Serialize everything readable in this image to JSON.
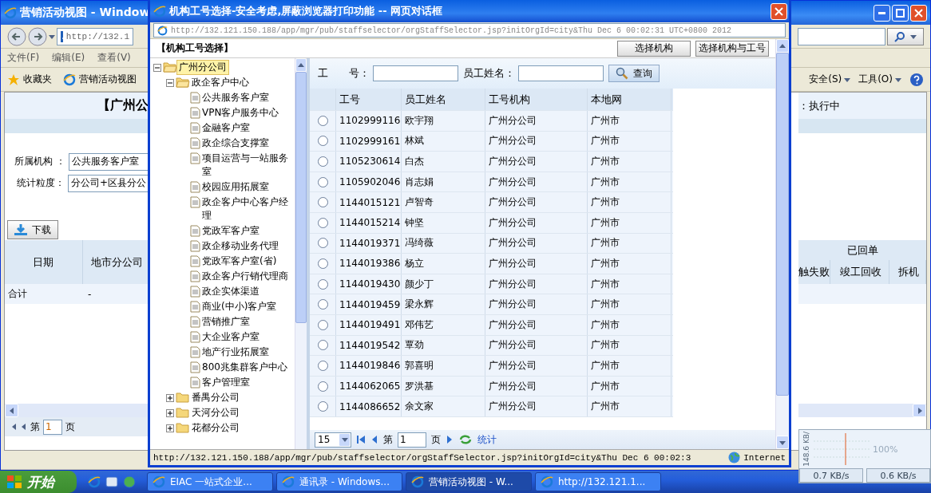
{
  "browser": {
    "title": "营销活动视图 - Window",
    "address": "http://132.1",
    "menu": [
      "文件(F)",
      "编辑(E)",
      "查看(V)"
    ],
    "favorites": "收藏夹",
    "tab": "营销活动视图",
    "right_menu": [
      "安全(S)",
      "工具(O)"
    ],
    "page": {
      "heading": "【广州公",
      "status": "：执行中",
      "fields": [
        {
          "label": "所属机构 ：",
          "value": "公共服务客户室"
        },
        {
          "label": "统计粒度：",
          "value": "分公司+区县分公"
        }
      ],
      "download": "下载",
      "table_left": {
        "columns": [
          "日期",
          "地市分公司"
        ],
        "row": [
          "合计",
          "-"
        ]
      },
      "table_right": {
        "group": "已回单",
        "columns": [
          "触失败",
          "竣工回收",
          "拆机"
        ]
      },
      "pager": {
        "prefix": "第",
        "page": "1",
        "suffix": "页"
      }
    }
  },
  "dialog": {
    "title": "机构工号选择-安全考虑,屏蔽浏览器打印功能 -- 网页对话框",
    "address": "http://132.121.150.188/app/mgr/pub/staffselector/orgStaffSelector.jsp?initOrgId=city&Thu Dec 6 00:02:31 UTC+0800 2012",
    "header": "【机构工号选择】",
    "buttons": [
      "选择机构",
      "选择机构与工号"
    ],
    "tree": [
      {
        "label": "广州分公司",
        "selected": true,
        "expanded": true,
        "children": [
          {
            "label": "政企客户中心",
            "selected": false,
            "expanded": true,
            "children": [
              {
                "label": "公共服务客户室",
                "selected": false
              },
              {
                "label": "VPN客户服务中心",
                "selected": false
              },
              {
                "label": "金融客户室",
                "selected": false
              },
              {
                "label": "政企综合支撑室",
                "selected": false
              },
              {
                "label": "项目运营与一站服务室",
                "selected": false
              },
              {
                "label": "校园应用拓展室",
                "selected": false
              },
              {
                "label": "政企客户中心客户经理",
                "selected": false
              },
              {
                "label": "党政军客户室",
                "selected": false
              },
              {
                "label": "政企移动业务代理",
                "selected": false
              },
              {
                "label": "党政军客户室(省)",
                "selected": false
              },
              {
                "label": "政企客户行销代理商",
                "selected": false
              },
              {
                "label": "政企实体渠道",
                "selected": false
              },
              {
                "label": "商业(中小)客户室",
                "selected": false
              },
              {
                "label": "营销推广室",
                "selected": false
              },
              {
                "label": "大企业客户室",
                "selected": false
              },
              {
                "label": "地产行业拓展室",
                "selected": false
              },
              {
                "label": "800兆集群客户中心",
                "selected": false
              },
              {
                "label": "客户管理室",
                "selected": false
              }
            ]
          },
          {
            "label": "番禺分公司",
            "selected": false,
            "expanded": false
          },
          {
            "label": "天河分公司",
            "selected": false,
            "expanded": false
          },
          {
            "label": "花都分公司",
            "selected": false,
            "expanded": false
          }
        ]
      }
    ],
    "search": {
      "fields": [
        {
          "label": "工　　号："
        },
        {
          "label": "员工姓名："
        }
      ],
      "button": "查询"
    },
    "table": {
      "columns": [
        "工号",
        "员工姓名",
        "工号机构",
        "本地网"
      ],
      "rows": [
        {
          "selected": false,
          "cells": [
            "1102999116",
            "欧宇翔",
            "广州分公司",
            "广州市"
          ]
        },
        {
          "selected": false,
          "cells": [
            "1102999161",
            "林斌",
            "广州分公司",
            "广州市"
          ]
        },
        {
          "selected": false,
          "cells": [
            "1105230614",
            "白杰",
            "广州分公司",
            "广州市"
          ]
        },
        {
          "selected": false,
          "cells": [
            "1105902046",
            "肖志娟",
            "广州分公司",
            "广州市"
          ]
        },
        {
          "selected": false,
          "cells": [
            "1144015121",
            "卢智奇",
            "广州分公司",
            "广州市"
          ]
        },
        {
          "selected": false,
          "cells": [
            "1144015214",
            "钟坚",
            "广州分公司",
            "广州市"
          ]
        },
        {
          "selected": false,
          "cells": [
            "1144019371",
            "冯绮薇",
            "广州分公司",
            "广州市"
          ]
        },
        {
          "selected": false,
          "cells": [
            "1144019386",
            "杨立",
            "广州分公司",
            "广州市"
          ]
        },
        {
          "selected": false,
          "cells": [
            "1144019430",
            "颜少丁",
            "广州分公司",
            "广州市"
          ]
        },
        {
          "selected": false,
          "cells": [
            "1144019459",
            "梁永辉",
            "广州分公司",
            "广州市"
          ]
        },
        {
          "selected": false,
          "cells": [
            "1144019491",
            "邓伟艺",
            "广州分公司",
            "广州市"
          ]
        },
        {
          "selected": false,
          "cells": [
            "1144019542",
            "覃劲",
            "广州分公司",
            "广州市"
          ]
        },
        {
          "selected": false,
          "cells": [
            "1144019846",
            "郭喜明",
            "广州分公司",
            "广州市"
          ]
        },
        {
          "selected": false,
          "cells": [
            "1144062065",
            "罗洪基",
            "广州分公司",
            "广州市"
          ]
        },
        {
          "selected": false,
          "cells": [
            "1144086652",
            "余文家",
            "广州分公司",
            "广州市"
          ]
        }
      ]
    },
    "pager": {
      "page_size": "15",
      "prefix": "第",
      "page": "1",
      "suffix": "页",
      "stats": "统计"
    },
    "status": "http://132.121.150.188/app/mgr/pub/staffselector/orgStaffSelector.jsp?initOrgId=city&Thu Dec 6 00:02:3",
    "zone": "Internet"
  },
  "taskbar": {
    "start": "开始",
    "tasks": [
      {
        "label": "EIAC 一站式企业...",
        "selected": false
      },
      {
        "label": "通讯录 - Windows...",
        "selected": false
      },
      {
        "label": "营销活动视图 - W...",
        "selected": true
      },
      {
        "label": "http://132.121.1...",
        "selected": false
      }
    ]
  },
  "net_meter": {
    "axis": "148.6 KB/",
    "zoom": "100%",
    "up": "0.7 KB/s",
    "down": "0.6 KB/s"
  }
}
